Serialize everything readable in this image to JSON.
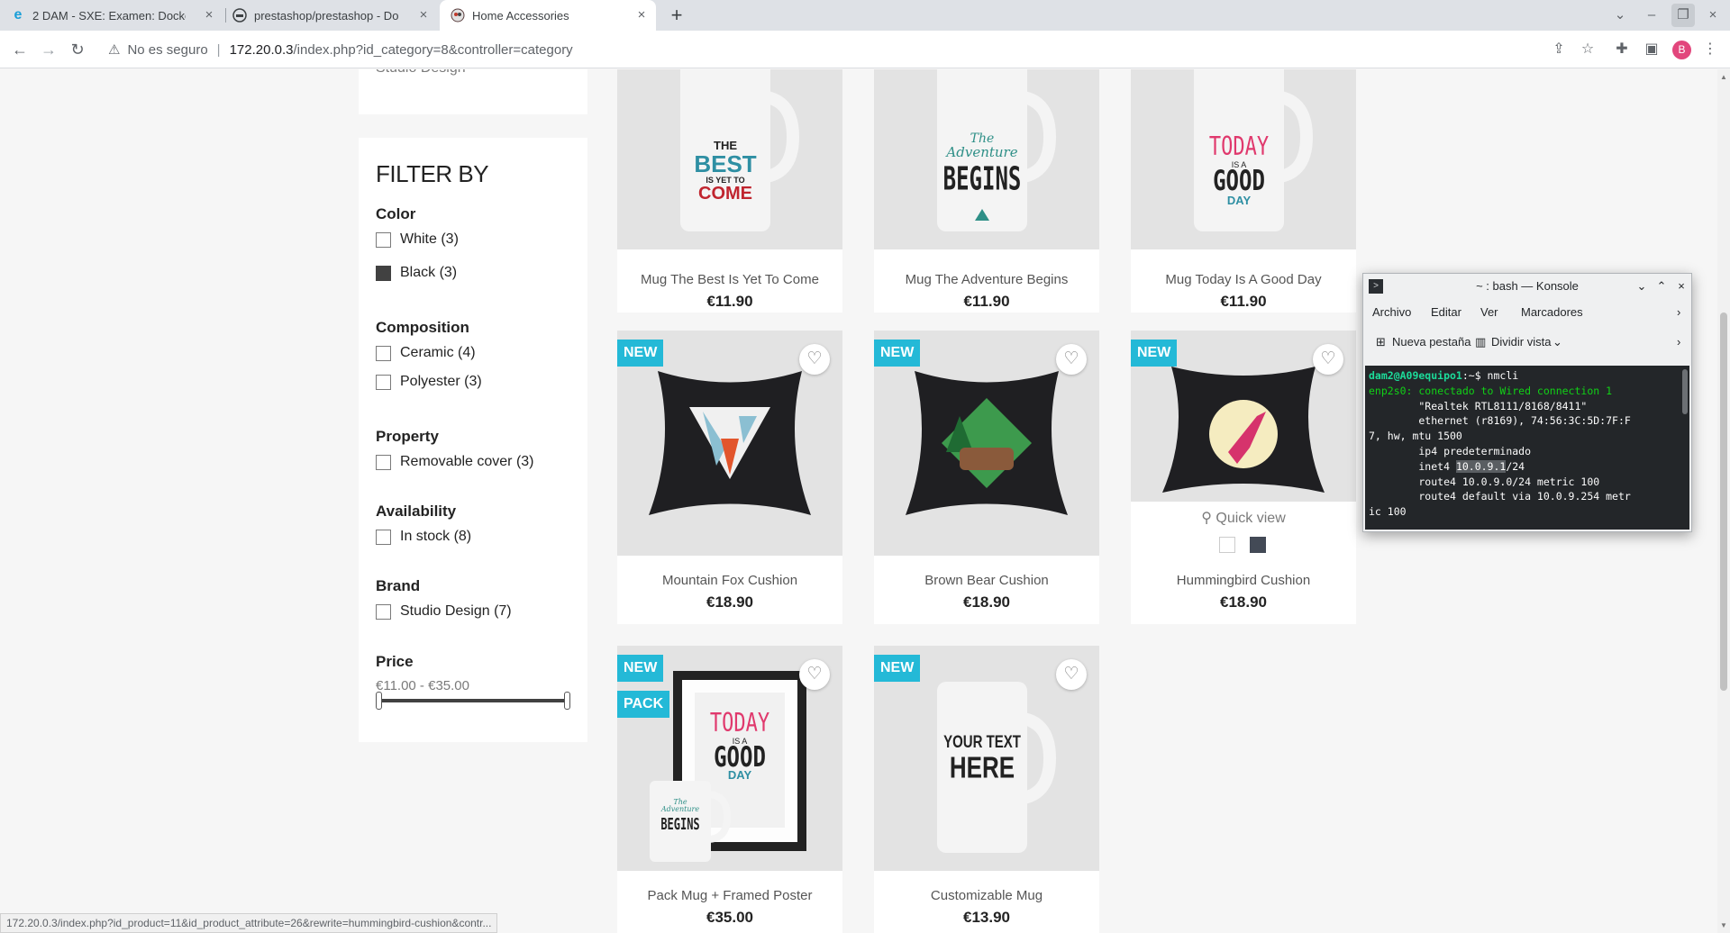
{
  "browser": {
    "tabs": [
      {
        "title": "2 DAM - SXE: Examen: Docke",
        "icon": "edge-e-icon"
      },
      {
        "title": "prestashop/prestashop - Do",
        "icon": "docker-icon"
      },
      {
        "title": "Home Accessories",
        "icon": "prestashop-icon"
      }
    ],
    "new_tab": "+",
    "security_label": "No es seguro",
    "url_host": "172.20.0.3",
    "url_path": "/index.php?id_category=8&controller=category",
    "profile_initial": "B"
  },
  "sidebar": {
    "top_block_text": "Studio Design",
    "filter_heading": "FILTER BY",
    "facets": [
      {
        "title": "Color",
        "options": [
          {
            "label": "White (3)",
            "checked": false
          },
          {
            "label": "Black (3)",
            "checked": true
          }
        ]
      },
      {
        "title": "Composition",
        "options": [
          {
            "label": "Ceramic (4)"
          },
          {
            "label": "Polyester (3)"
          }
        ]
      },
      {
        "title": "Property",
        "options": [
          {
            "label": "Removable cover (3)"
          }
        ]
      },
      {
        "title": "Availability",
        "options": [
          {
            "label": "In stock (8)"
          }
        ]
      },
      {
        "title": "Brand",
        "options": [
          {
            "label": "Studio Design (7)"
          }
        ]
      }
    ],
    "price": {
      "title": "Price",
      "range": "€11.00 - €35.00"
    }
  },
  "products": [
    {
      "name": "Mug The Best Is Yet To Come",
      "price": "€11.90",
      "art": [
        "THE",
        "BEST",
        "IS YET TO",
        "COME"
      ]
    },
    {
      "name": "Mug The Adventure Begins",
      "price": "€11.90",
      "art": [
        "The",
        "Adventure",
        "BEGINS"
      ]
    },
    {
      "name": "Mug Today Is A Good Day",
      "price": "€11.90",
      "art": [
        "TODAY",
        "IS A",
        "GOOD",
        "DAY"
      ]
    },
    {
      "name": "Mountain Fox Cushion",
      "price": "€18.90",
      "flags": [
        "NEW"
      ]
    },
    {
      "name": "Brown Bear Cushion",
      "price": "€18.90",
      "flags": [
        "NEW"
      ]
    },
    {
      "name": "Hummingbird Cushion",
      "price": "€18.90",
      "flags": [
        "NEW"
      ],
      "quick_view": "Quick view"
    },
    {
      "name": "Pack Mug + Framed Poster",
      "price": "€35.00",
      "flags": [
        "NEW",
        "PACK"
      ],
      "art": [
        "TODAY",
        "IS A",
        "GOOD",
        "DAY",
        "The",
        "Adventure",
        "BEGINS"
      ]
    },
    {
      "name": "Customizable Mug",
      "price": "€13.90",
      "flags": [
        "NEW"
      ],
      "art": [
        "YOUR TEXT",
        "HERE"
      ]
    }
  ],
  "konsole": {
    "title": "~ : bash — Konsole",
    "menu": [
      "Archivo",
      "Editar",
      "Ver",
      "Marcadores"
    ],
    "toolbar": [
      "Nueva pestaña",
      "Dividir vista"
    ],
    "terminal": {
      "prompt": "dam2@A09equipo1",
      "prompt_suffix": ":~$ nmcli",
      "iface": "enp2s0: conectado to Wired connection 1",
      "lines": [
        "        \"Realtek RTL8111/8168/8411\"",
        "        ethernet (r8169), 74:56:3C:5D:7F:F",
        "7, hw, mtu 1500",
        "        ip4 predeterminado"
      ],
      "inet_prefix": "        inet4 ",
      "inet_selected": "10.0.9.1",
      "inet_suffix": "/24",
      "lines2": [
        "        route4 10.0.9.0/24 metric 100",
        "        route4 default via 10.0.9.254 metr",
        "ic 100"
      ]
    }
  },
  "status_url": "172.20.0.3/index.php?id_product=11&id_product_attribute=26&rewrite=hummingbird-cushion&contr...",
  "colors": {
    "accent": "#24b9d7",
    "swatch_white": "#ffffff",
    "swatch_black": "#434a56"
  }
}
